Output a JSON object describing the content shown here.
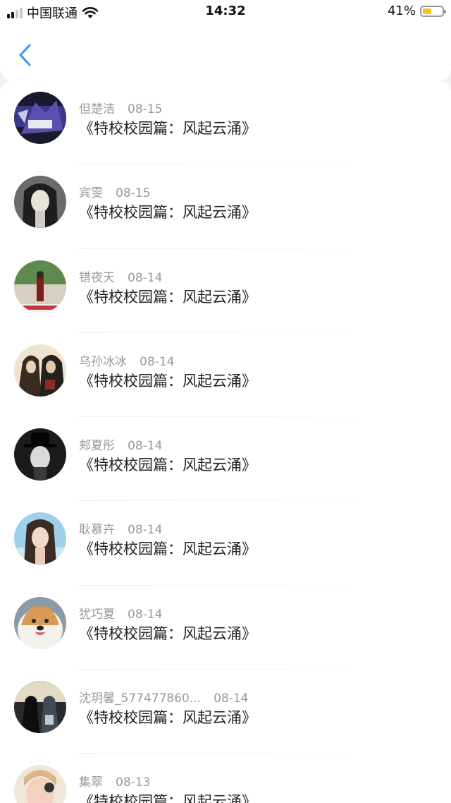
{
  "status_bar": {
    "carrier": "中国联通",
    "time": "14:32",
    "battery": "41%"
  },
  "nav": {
    "back_icon": "chevron-left-icon",
    "accent_color": "#4a9be8"
  },
  "items": [
    {
      "name": "但楚洁",
      "date": "08-15",
      "message": "《特校校园篇：风起云涌》"
    },
    {
      "name": "宾雯",
      "date": "08-15",
      "message": "《特校校园篇：风起云涌》"
    },
    {
      "name": "错夜天",
      "date": "08-14",
      "message": "《特校校园篇：风起云涌》"
    },
    {
      "name": "乌孙冰冰",
      "date": "08-14",
      "message": "《特校校园篇：风起云涌》"
    },
    {
      "name": "郏夏彤",
      "date": "08-14",
      "message": "《特校校园篇：风起云涌》"
    },
    {
      "name": "耿慕卉",
      "date": "08-14",
      "message": "《特校校园篇：风起云涌》"
    },
    {
      "name": "犹巧夏",
      "date": "08-14",
      "message": "《特校校园篇：风起云涌》"
    },
    {
      "name": "沈玥馨_577477860...",
      "date": "08-14",
      "message": "《特校校园篇：风起云涌》"
    },
    {
      "name": "集翠",
      "date": "08-13",
      "message": "《特校校园篇：风起云涌》"
    }
  ]
}
